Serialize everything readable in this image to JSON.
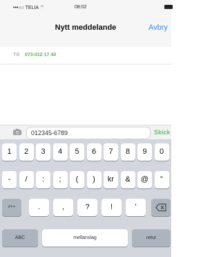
{
  "status": {
    "carrier": "•••○○ TELIA ⌔",
    "time": "08:02"
  },
  "nav": {
    "title": "Nytt meddelande",
    "cancel": "Avbry"
  },
  "recipient": {
    "label": "Till:",
    "value": "073-012 17 40"
  },
  "compose": {
    "text": "012345-6789",
    "send": "Skick"
  },
  "keyboard": {
    "row1": [
      "1",
      "2",
      "3",
      "4",
      "5",
      "6",
      "7",
      "8",
      "9",
      "0"
    ],
    "row2": [
      "-",
      "/",
      ":",
      ";",
      "(",
      ")",
      "kr",
      "&",
      "@",
      "\""
    ],
    "row3_toggle": "#+=",
    "row3": [
      ".",
      ",",
      "?",
      "!",
      "'"
    ],
    "backspace_icon": "backspace-icon",
    "abc": "ABC",
    "space": "mellanslag",
    "return": "retur"
  }
}
